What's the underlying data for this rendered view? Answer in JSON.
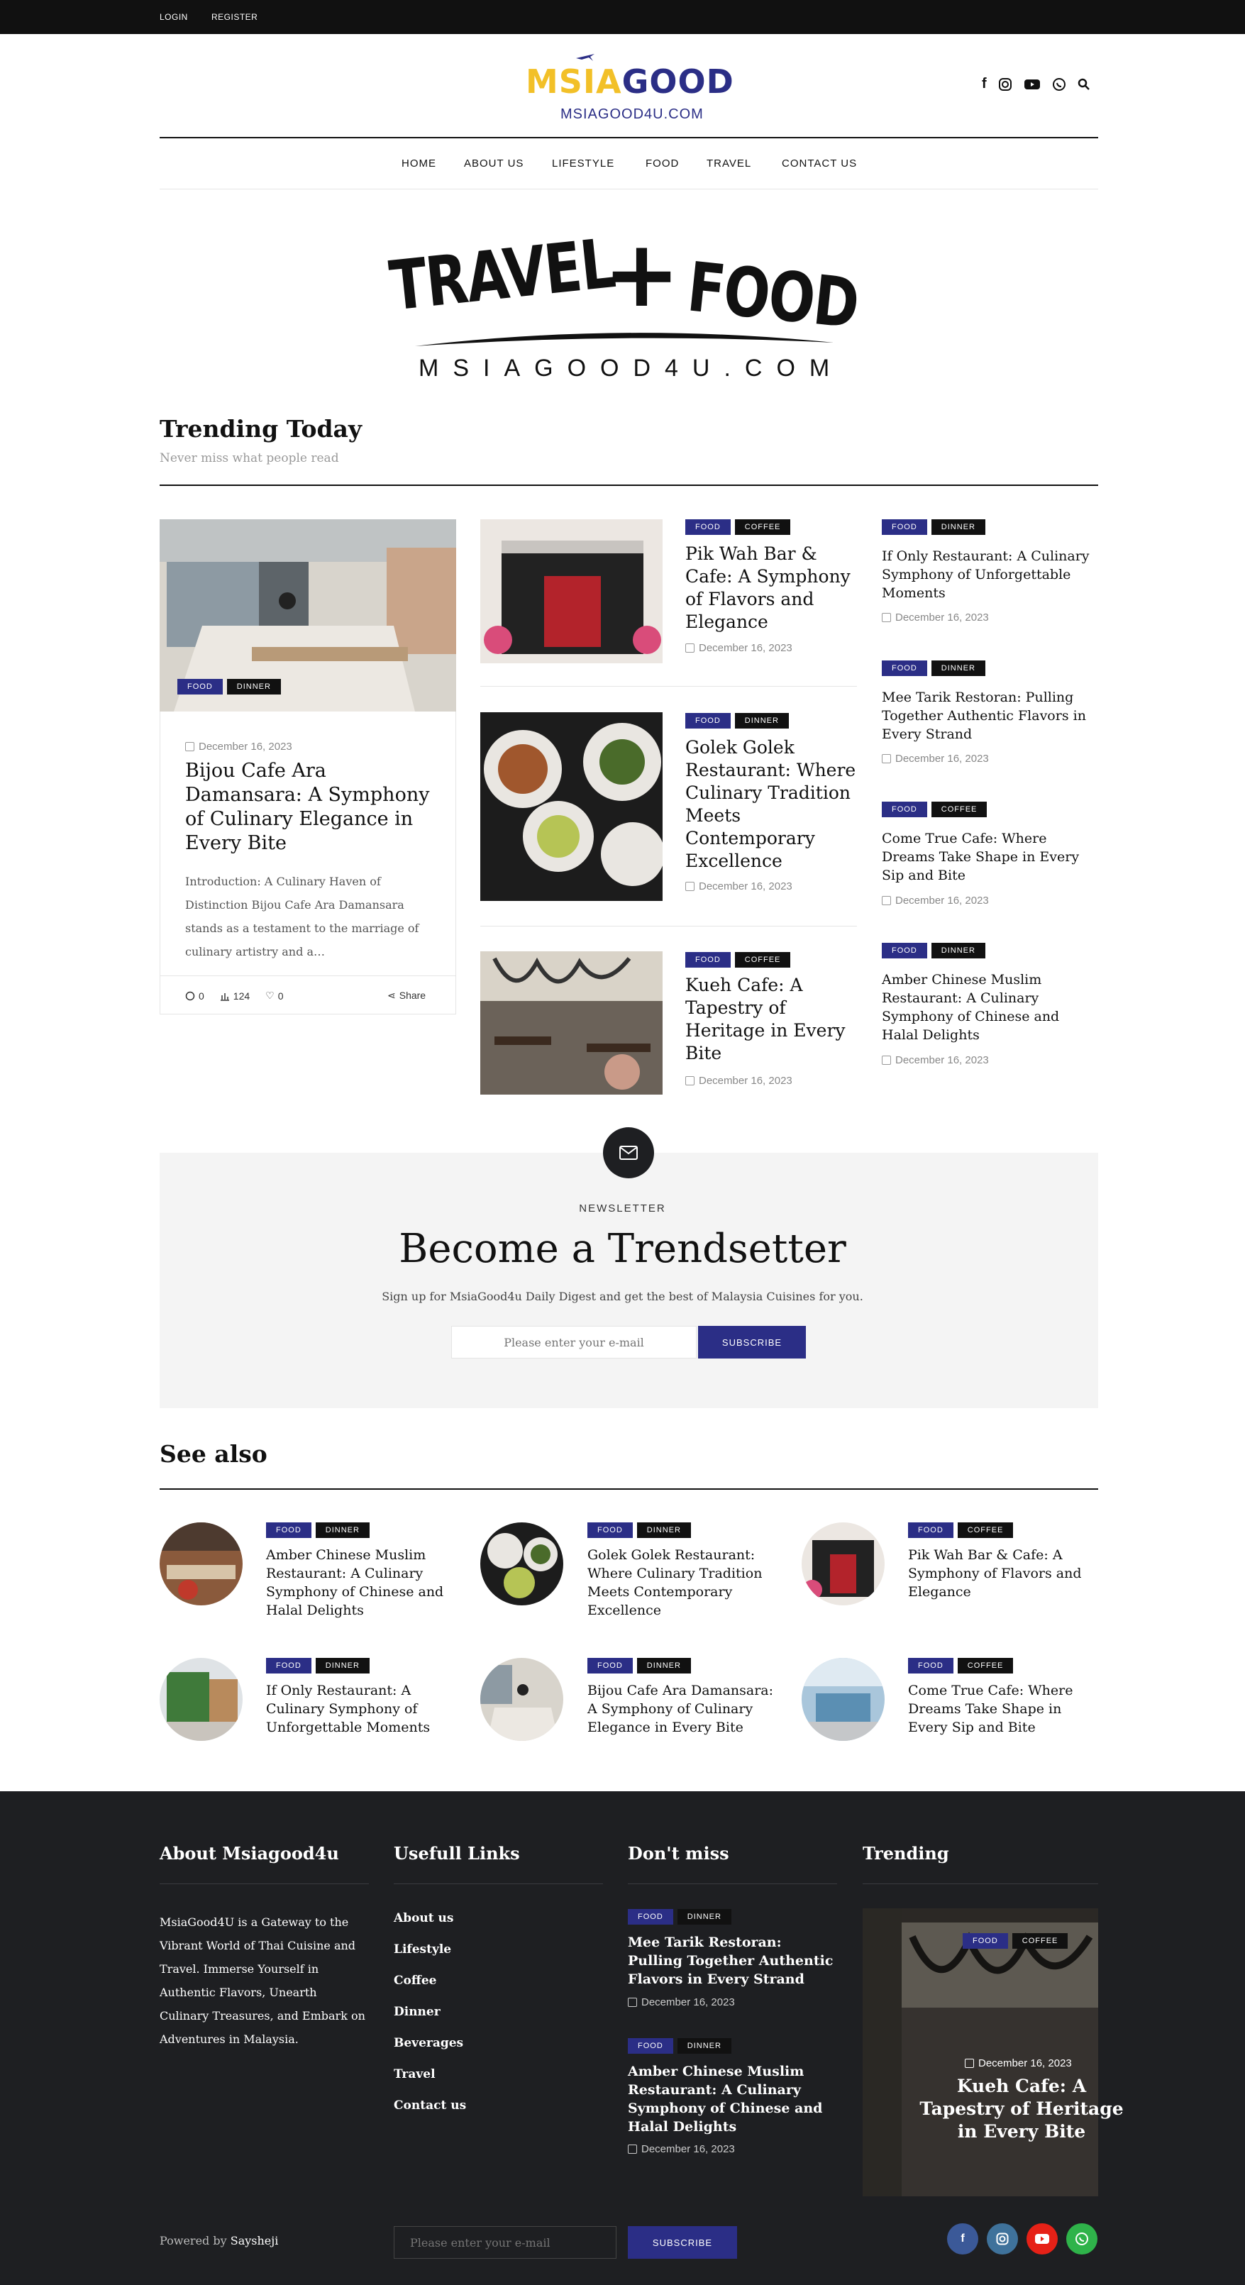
{
  "topbar": {
    "login": "LOGIN",
    "register": "REGISTER"
  },
  "header": {
    "logo_part1": "MSIA",
    "logo_part2": "GOOD",
    "logo_url": "MSIAGOOD4U.COM",
    "icons": [
      "facebook-icon",
      "instagram-icon",
      "youtube-icon",
      "whatsapp-icon",
      "search-icon"
    ]
  },
  "nav": [
    "HOME",
    "ABOUT US",
    "LIFESTYLE",
    "FOOD",
    "TRAVEL",
    "CONTACT US"
  ],
  "banner": {
    "left": "TRAVEL",
    "plus": "+",
    "right": "FOOD",
    "domain": "MSIAGOOD4U.COM"
  },
  "trending": {
    "title": "Trending Today",
    "subtitle": "Never miss what people read",
    "featured": {
      "tags": [
        "FOOD",
        "DINNER"
      ],
      "date": "December 16, 2023",
      "title": "Bijou Cafe Ara Damansara: A Symphony of Culinary Elegance in Every Bite",
      "excerpt": "Introduction: A Culinary Haven of Distinction Bijou Cafe Ara Damansara stands as a testament to the marriage of culinary artistry and a…",
      "comments": "0",
      "views": "124",
      "likes": "0",
      "share": "Share"
    },
    "middle": [
      {
        "tags": [
          "FOOD",
          "COFFEE"
        ],
        "title": "Pik Wah Bar & Cafe: A Symphony of Flavors and Elegance",
        "date": "December 16, 2023"
      },
      {
        "tags": [
          "FOOD",
          "DINNER"
        ],
        "title": "Golek Golek Restaurant: Where Culinary Tradition Meets Contemporary Excellence",
        "date": "December 16, 2023"
      },
      {
        "tags": [
          "FOOD",
          "COFFEE"
        ],
        "title": "Kueh Cafe: A Tapestry of Heritage in Every Bite",
        "date": "December 16, 2023"
      }
    ],
    "right": [
      {
        "tags": [
          "FOOD",
          "DINNER"
        ],
        "title": "If Only Restaurant: A Culinary Symphony of Unforgettable Moments",
        "date": "December 16, 2023"
      },
      {
        "tags": [
          "FOOD",
          "DINNER"
        ],
        "title": "Mee Tarik Restoran: Pulling Together Authentic Flavors in Every Strand",
        "date": "December 16, 2023"
      },
      {
        "tags": [
          "FOOD",
          "COFFEE"
        ],
        "title": "Come True Cafe: Where Dreams Take Shape in Every Sip and Bite",
        "date": "December 16, 2023"
      },
      {
        "tags": [
          "FOOD",
          "DINNER"
        ],
        "title": "Amber Chinese Muslim Restaurant: A Culinary Symphony of Chinese and Halal Delights",
        "date": "December 16, 2023"
      }
    ]
  },
  "newsletter": {
    "label": "NEWSLETTER",
    "title": "Become a Trendsetter",
    "text": "Sign up for MsiaGood4u Daily Digest and get the best of Malaysia Cuisines for you.",
    "placeholder": "Please enter your e-mail",
    "button": "SUBSCRIBE"
  },
  "see_also": {
    "title": "See also",
    "items": [
      {
        "tags": [
          "FOOD",
          "DINNER"
        ],
        "title": "Amber Chinese Muslim Restaurant: A Culinary Symphony of Chinese and Halal Delights"
      },
      {
        "tags": [
          "FOOD",
          "DINNER"
        ],
        "title": "Golek Golek Restaurant: Where Culinary Tradition Meets Contemporary Excellence"
      },
      {
        "tags": [
          "FOOD",
          "COFFEE"
        ],
        "title": "Pik Wah Bar & Cafe: A Symphony of Flavors and Elegance"
      },
      {
        "tags": [
          "FOOD",
          "DINNER"
        ],
        "title": "If Only Restaurant: A Culinary Symphony of Unforgettable Moments"
      },
      {
        "tags": [
          "FOOD",
          "DINNER"
        ],
        "title": "Bijou Cafe Ara Damansara: A Symphony of Culinary Elegance in Every Bite"
      },
      {
        "tags": [
          "FOOD",
          "COFFEE"
        ],
        "title": "Come True Cafe: Where Dreams Take Shape in Every Sip and Bite"
      }
    ]
  },
  "footer": {
    "about_title": "About Msiagood4u",
    "about_text": "MsiaGood4U is a Gateway to the Vibrant World of Thai Cuisine and Travel. Immerse Yourself in Authentic Flavors, Unearth Culinary Treasures, and Embark on Adventures in Malaysia.",
    "links_title": "Usefull Links",
    "links": [
      "About us",
      "Lifestyle",
      "Coffee",
      "Dinner",
      "Beverages",
      "Travel",
      "Contact us"
    ],
    "dontmiss_title": "Don't miss",
    "dontmiss": [
      {
        "tags": [
          "FOOD",
          "DINNER"
        ],
        "title": "Mee Tarik Restoran: Pulling Together Authentic Flavors in Every Strand",
        "date": "December 16, 2023"
      },
      {
        "tags": [
          "FOOD",
          "DINNER"
        ],
        "title": "Amber Chinese Muslim Restaurant: A Culinary Symphony of Chinese and Halal Delights",
        "date": "December 16, 2023"
      }
    ],
    "trending_title": "Trending",
    "trending_card": {
      "tags": [
        "FOOD",
        "COFFEE"
      ],
      "date": "December 16, 2023",
      "title": "Kueh Cafe: A Tapestry of Heritage in Every Bite"
    },
    "powered_label": "Powered by",
    "powered_name": "Saysheji",
    "email_placeholder": "Please enter your e-mail",
    "subscribe": "SUBSCRIBE",
    "social": [
      "facebook-icon",
      "instagram-icon",
      "youtube-icon",
      "whatsapp-icon"
    ]
  },
  "colors": {
    "brand_blue": "#2b2e86",
    "brand_yellow": "#f2c028",
    "dark": "#111111",
    "footer_bg": "#1e1f22"
  }
}
